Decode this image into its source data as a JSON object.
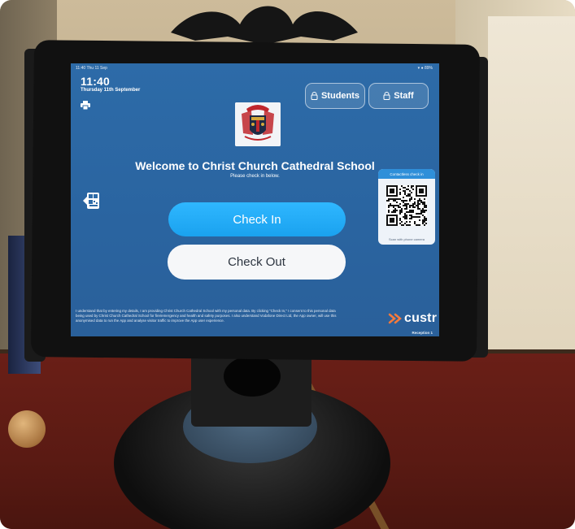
{
  "status_bar": {
    "left": "11:40  Thu 11 Sep",
    "right": "▾ ● 89%"
  },
  "header": {
    "time": "11:40",
    "date": "Thursday 11th September"
  },
  "buttons": {
    "students": "Students",
    "staff": "Staff",
    "check_in": "Check In",
    "check_out": "Check Out"
  },
  "main": {
    "welcome": "Welcome to Christ Church Cathedral School",
    "subtitle": "Please check in below."
  },
  "qr_card": {
    "title": "Contactless check in",
    "footer": "Scan with phone camera"
  },
  "footer": {
    "disclaimer": "I understand that by entering my details, I am providing Christ Church Cathedral School with my personal data. By clicking \"Check In,\" I consent to this personal data being used by Christ Church Cathedral School for fire/emergency and health and safety purposes. I also understand Vodafone Direct Ltd, the App owner, will use this anonymised data to run the App and analyse visitor traffic to improve the App user experience.",
    "brand": "custr",
    "location": "Reception 1"
  },
  "icons": {
    "print": "printer-icon",
    "lock": "lock-icon",
    "qr": "qr-code-icon",
    "brand": "custr-logo-icon"
  },
  "colors": {
    "screen_bg": "#2d6ba8",
    "check_in": "#1aa2ef",
    "check_out": "#f6f7f9",
    "brand_orange": "#f47a3c"
  }
}
